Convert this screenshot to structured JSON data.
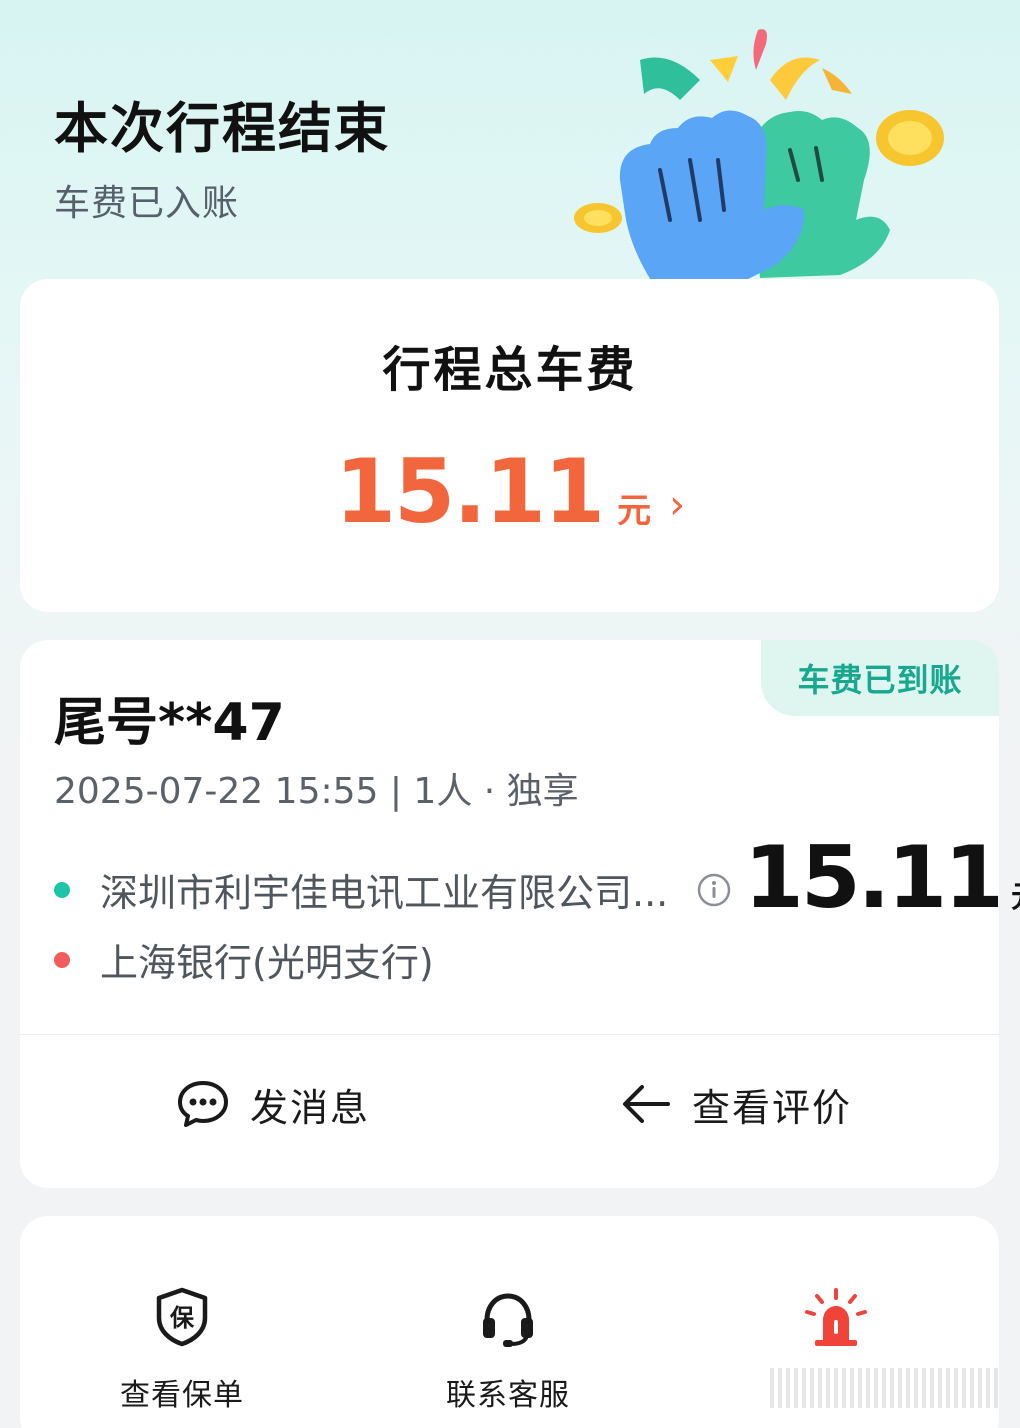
{
  "header": {
    "title": "本次行程结束",
    "subtitle": "车费已入账"
  },
  "fare_card": {
    "label": "行程总车费",
    "amount": "15.11",
    "unit": "元",
    "chevron": "›",
    "accent_color": "#f2663d"
  },
  "trip_card": {
    "badge": "车费已到账",
    "badge_color": "#18a890",
    "plate": "尾号**47",
    "meta": "2025-07-22 15:55 | 1人 · 独享",
    "route_from": "深圳市利宇佳电讯工业有限公司...",
    "route_to": "上海银行(光明支行)",
    "amount": "15.11",
    "unit": "元",
    "actions": {
      "message_label": "发消息",
      "message_icon": "chat-bubble-icon",
      "review_label": "查看评价",
      "review_icon": "arrow-left-icon"
    }
  },
  "services": [
    {
      "label": "查看保单",
      "icon": "insurance-shield-icon"
    },
    {
      "label": "联系客服",
      "icon": "headset-icon"
    },
    {
      "label": "",
      "icon": "alarm-siren-icon",
      "color": "#f0443a"
    }
  ]
}
